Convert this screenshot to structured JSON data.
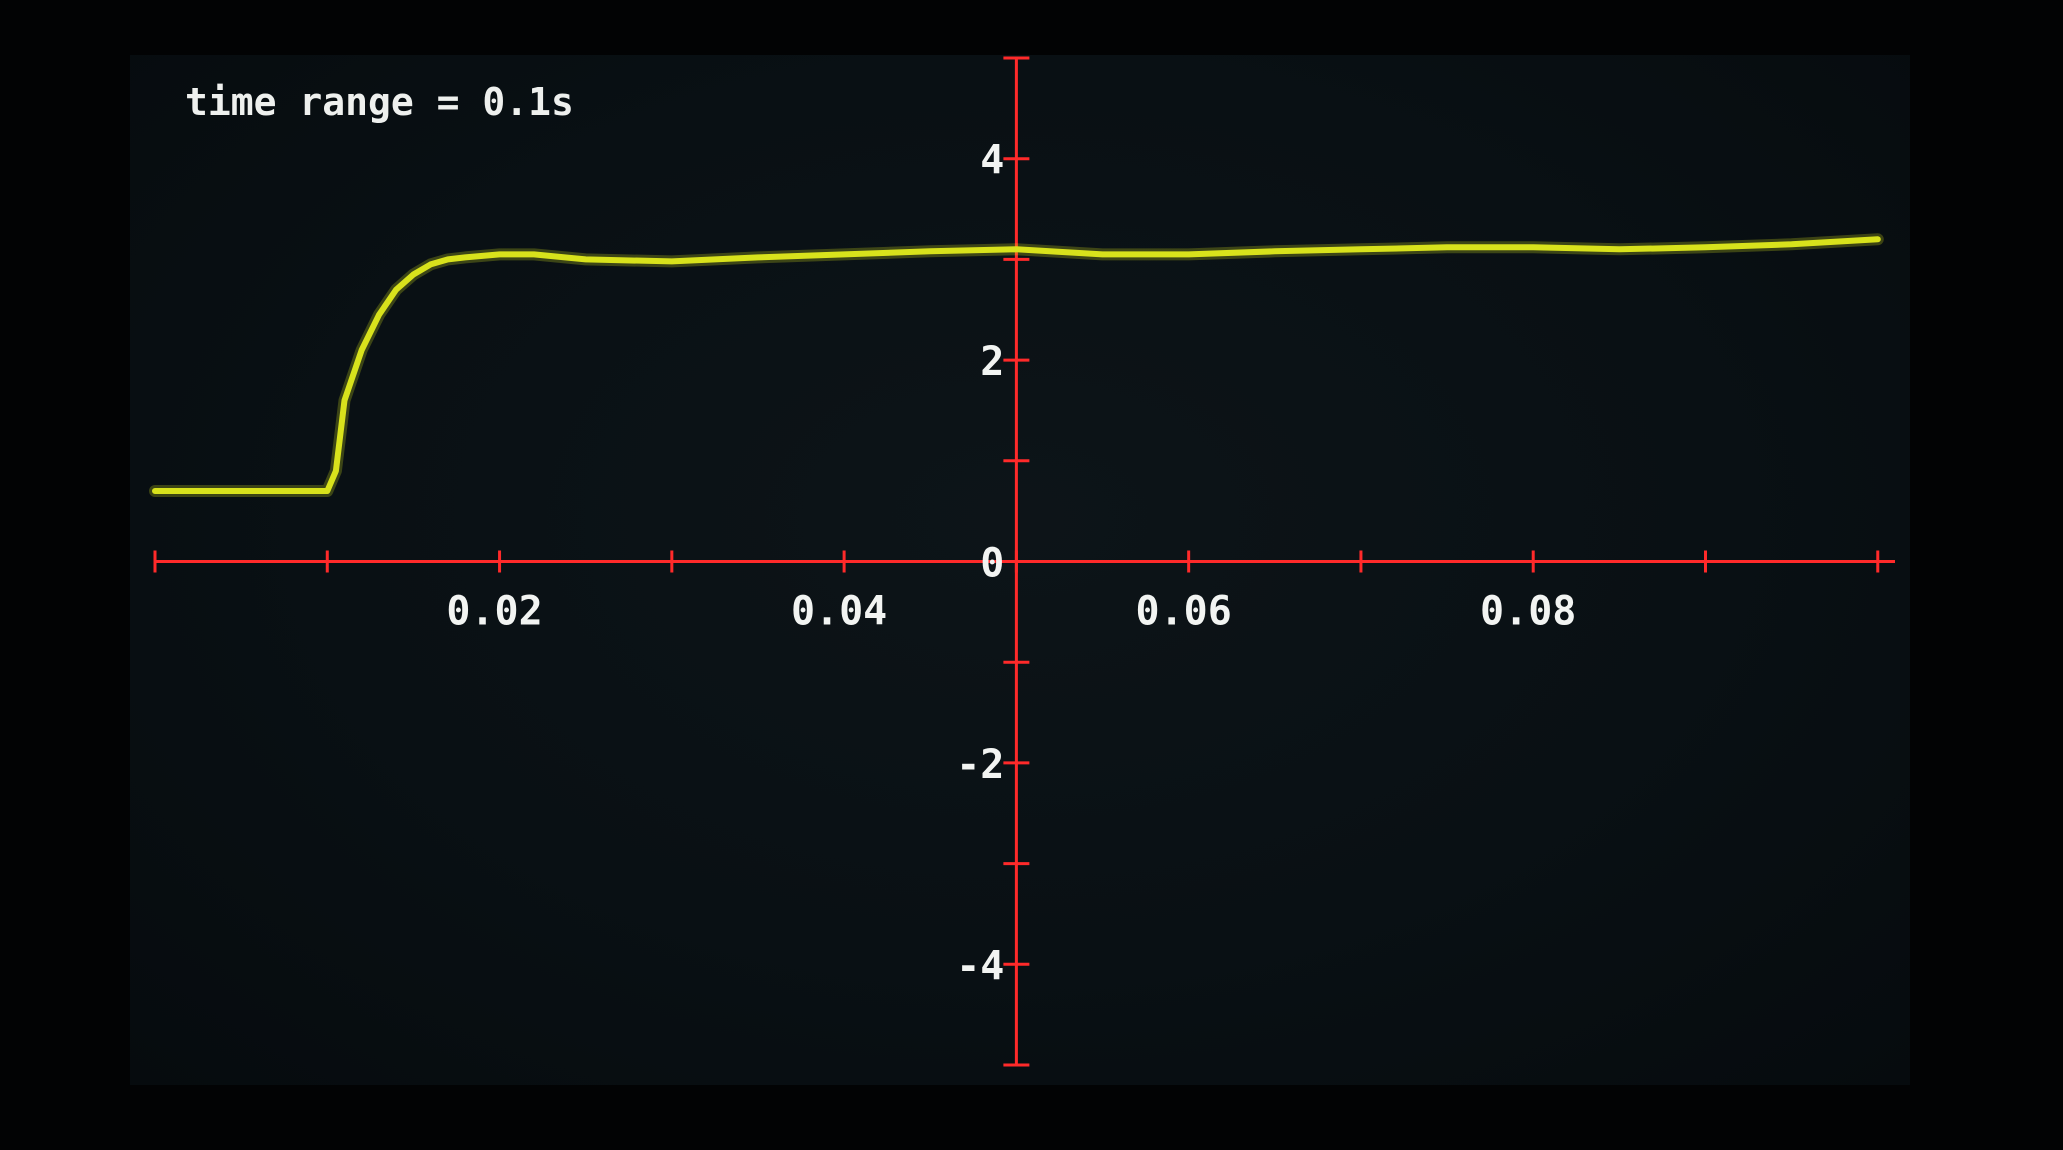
{
  "display": {
    "info_text": "time range = 0.1s"
  },
  "colors": {
    "background": "#020304",
    "screen": "#0a1115",
    "axes": "#ff2a2a",
    "trace": "#d8e21c",
    "text": "#f2f4f2"
  },
  "chart_data": {
    "type": "line",
    "title": "",
    "xlabel": "",
    "ylabel": "",
    "xlim": [
      -0.05,
      0.051
    ],
    "ylim": [
      -5,
      5
    ],
    "x_ticks": [
      -0.05,
      -0.04,
      -0.03,
      -0.02,
      -0.01,
      0.0,
      0.01,
      0.02,
      0.03,
      0.04,
      0.05
    ],
    "x_tick_labels": [
      "0.02",
      "0.04",
      "0.06",
      "0.08"
    ],
    "x_tick_label_values": [
      -0.03,
      -0.01,
      0.01,
      0.03
    ],
    "y_ticks": [
      -5,
      -4,
      -3,
      -2,
      -1,
      0,
      1,
      2,
      3,
      4,
      5
    ],
    "y_tick_labels": [
      "4",
      "2",
      "0",
      "-2",
      "-4"
    ],
    "y_tick_label_values": [
      4,
      2,
      0,
      -2,
      -4
    ],
    "grid": false,
    "series": [
      {
        "x": [
          -0.05,
          -0.045,
          -0.04,
          -0.0395,
          -0.039,
          -0.038,
          -0.037,
          -0.036,
          -0.035,
          -0.034,
          -0.033,
          -0.032,
          -0.03,
          -0.028,
          -0.025,
          -0.02,
          -0.015,
          -0.01,
          -0.005,
          0.0,
          0.005,
          0.01,
          0.015,
          0.02,
          0.025,
          0.03,
          0.035,
          0.04,
          0.045,
          0.05
        ],
        "y": [
          0.7,
          0.7,
          0.7,
          0.9,
          1.6,
          2.1,
          2.45,
          2.7,
          2.85,
          2.95,
          3.0,
          3.02,
          3.05,
          3.05,
          3.0,
          2.98,
          3.02,
          3.05,
          3.08,
          3.1,
          3.05,
          3.05,
          3.08,
          3.1,
          3.12,
          3.12,
          3.1,
          3.12,
          3.15,
          3.2
        ]
      }
    ]
  }
}
